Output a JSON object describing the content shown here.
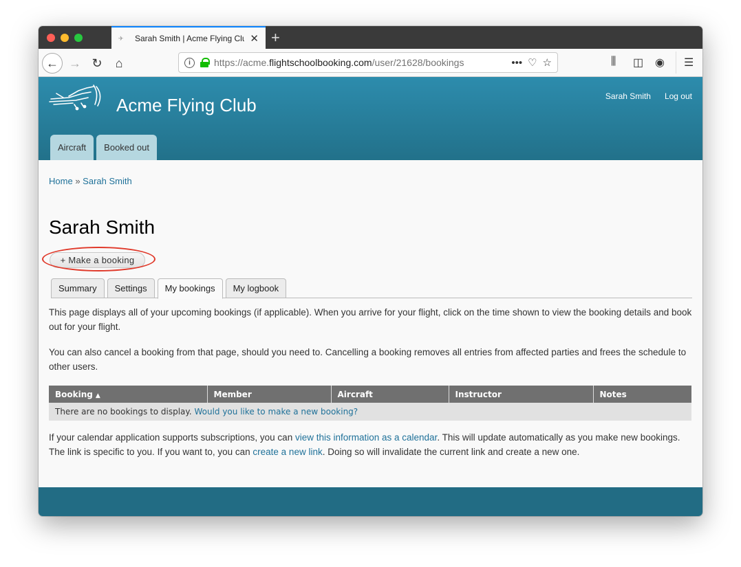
{
  "browser": {
    "tab_title": "Sarah Smith | Acme Flying Club",
    "tab_favicon": "plane-icon",
    "url_scheme": "https://acme.",
    "url_domain": "flightschoolbooking.com",
    "url_path": "/user/21628/bookings",
    "page_actions_label": "•••",
    "icons": [
      "back-icon",
      "forward-icon",
      "reload-icon",
      "home-icon",
      "info-icon",
      "lock-icon",
      "pocket-icon",
      "star-icon",
      "library-icon",
      "sidebar-icon",
      "account-icon",
      "menu-icon"
    ]
  },
  "site": {
    "name": "Acme Flying Club",
    "user_links": [
      "Sarah Smith",
      "Log out"
    ],
    "main_tabs": [
      "Aircraft",
      "Booked out"
    ],
    "accent_color": "#2d8cad",
    "link_color": "#1f7199"
  },
  "breadcrumb": {
    "home": "Home",
    "separator": "»",
    "current": "Sarah Smith"
  },
  "page": {
    "title": "Sarah Smith",
    "make_booking_button": "+ Make a booking",
    "sub_tabs": [
      {
        "label": "Summary",
        "active": false
      },
      {
        "label": "Settings",
        "active": false
      },
      {
        "label": "My bookings",
        "active": true
      },
      {
        "label": "My logbook",
        "active": false
      }
    ],
    "intro_1": "This page displays all of your upcoming bookings (if applicable). When you arrive for your flight, click on the time shown to view the booking details and book out for your flight.",
    "intro_2": "You can also cancel a booking from that page, should you need to. Cancelling a booking removes all entries from affected parties and frees the schedule to other users.",
    "table": {
      "columns": [
        "Booking",
        "Member",
        "Aircraft",
        "Instructor",
        "Notes"
      ],
      "sort_column": "Booking",
      "sort_direction": "ascending",
      "empty_text": "There are no bookings to display.",
      "empty_link": "Would you like to make a new booking?"
    },
    "calendar": {
      "text_1": "If your calendar application supports subscriptions, you can ",
      "link_1": "view this information as a calendar",
      "text_2": ". This will update automatically as you make new bookings. The link is specific to you. If you want to, you can ",
      "link_2": "create a new link",
      "text_3": ". Doing so will invalidate the current link and create a new one."
    }
  }
}
